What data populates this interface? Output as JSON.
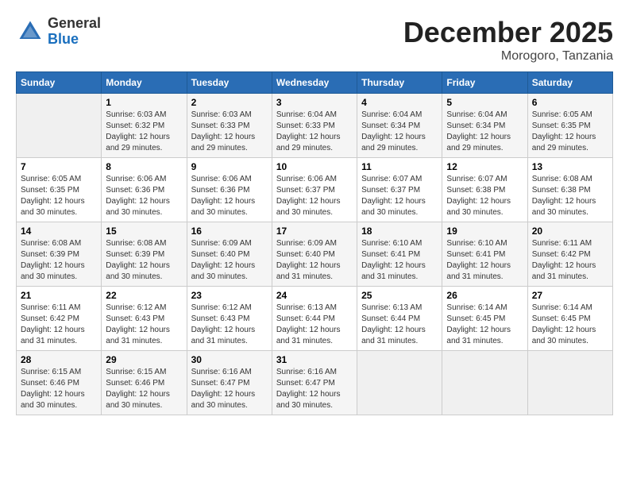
{
  "header": {
    "logo_general": "General",
    "logo_blue": "Blue",
    "month_title": "December 2025",
    "location": "Morogoro, Tanzania"
  },
  "weekdays": [
    "Sunday",
    "Monday",
    "Tuesday",
    "Wednesday",
    "Thursday",
    "Friday",
    "Saturday"
  ],
  "weeks": [
    [
      {
        "day": "",
        "sunrise": "",
        "sunset": "",
        "daylight": ""
      },
      {
        "day": "1",
        "sunrise": "Sunrise: 6:03 AM",
        "sunset": "Sunset: 6:32 PM",
        "daylight": "Daylight: 12 hours and 29 minutes."
      },
      {
        "day": "2",
        "sunrise": "Sunrise: 6:03 AM",
        "sunset": "Sunset: 6:33 PM",
        "daylight": "Daylight: 12 hours and 29 minutes."
      },
      {
        "day": "3",
        "sunrise": "Sunrise: 6:04 AM",
        "sunset": "Sunset: 6:33 PM",
        "daylight": "Daylight: 12 hours and 29 minutes."
      },
      {
        "day": "4",
        "sunrise": "Sunrise: 6:04 AM",
        "sunset": "Sunset: 6:34 PM",
        "daylight": "Daylight: 12 hours and 29 minutes."
      },
      {
        "day": "5",
        "sunrise": "Sunrise: 6:04 AM",
        "sunset": "Sunset: 6:34 PM",
        "daylight": "Daylight: 12 hours and 29 minutes."
      },
      {
        "day": "6",
        "sunrise": "Sunrise: 6:05 AM",
        "sunset": "Sunset: 6:35 PM",
        "daylight": "Daylight: 12 hours and 29 minutes."
      }
    ],
    [
      {
        "day": "7",
        "sunrise": "Sunrise: 6:05 AM",
        "sunset": "Sunset: 6:35 PM",
        "daylight": "Daylight: 12 hours and 30 minutes."
      },
      {
        "day": "8",
        "sunrise": "Sunrise: 6:06 AM",
        "sunset": "Sunset: 6:36 PM",
        "daylight": "Daylight: 12 hours and 30 minutes."
      },
      {
        "day": "9",
        "sunrise": "Sunrise: 6:06 AM",
        "sunset": "Sunset: 6:36 PM",
        "daylight": "Daylight: 12 hours and 30 minutes."
      },
      {
        "day": "10",
        "sunrise": "Sunrise: 6:06 AM",
        "sunset": "Sunset: 6:37 PM",
        "daylight": "Daylight: 12 hours and 30 minutes."
      },
      {
        "day": "11",
        "sunrise": "Sunrise: 6:07 AM",
        "sunset": "Sunset: 6:37 PM",
        "daylight": "Daylight: 12 hours and 30 minutes."
      },
      {
        "day": "12",
        "sunrise": "Sunrise: 6:07 AM",
        "sunset": "Sunset: 6:38 PM",
        "daylight": "Daylight: 12 hours and 30 minutes."
      },
      {
        "day": "13",
        "sunrise": "Sunrise: 6:08 AM",
        "sunset": "Sunset: 6:38 PM",
        "daylight": "Daylight: 12 hours and 30 minutes."
      }
    ],
    [
      {
        "day": "14",
        "sunrise": "Sunrise: 6:08 AM",
        "sunset": "Sunset: 6:39 PM",
        "daylight": "Daylight: 12 hours and 30 minutes."
      },
      {
        "day": "15",
        "sunrise": "Sunrise: 6:08 AM",
        "sunset": "Sunset: 6:39 PM",
        "daylight": "Daylight: 12 hours and 30 minutes."
      },
      {
        "day": "16",
        "sunrise": "Sunrise: 6:09 AM",
        "sunset": "Sunset: 6:40 PM",
        "daylight": "Daylight: 12 hours and 30 minutes."
      },
      {
        "day": "17",
        "sunrise": "Sunrise: 6:09 AM",
        "sunset": "Sunset: 6:40 PM",
        "daylight": "Daylight: 12 hours and 31 minutes."
      },
      {
        "day": "18",
        "sunrise": "Sunrise: 6:10 AM",
        "sunset": "Sunset: 6:41 PM",
        "daylight": "Daylight: 12 hours and 31 minutes."
      },
      {
        "day": "19",
        "sunrise": "Sunrise: 6:10 AM",
        "sunset": "Sunset: 6:41 PM",
        "daylight": "Daylight: 12 hours and 31 minutes."
      },
      {
        "day": "20",
        "sunrise": "Sunrise: 6:11 AM",
        "sunset": "Sunset: 6:42 PM",
        "daylight": "Daylight: 12 hours and 31 minutes."
      }
    ],
    [
      {
        "day": "21",
        "sunrise": "Sunrise: 6:11 AM",
        "sunset": "Sunset: 6:42 PM",
        "daylight": "Daylight: 12 hours and 31 minutes."
      },
      {
        "day": "22",
        "sunrise": "Sunrise: 6:12 AM",
        "sunset": "Sunset: 6:43 PM",
        "daylight": "Daylight: 12 hours and 31 minutes."
      },
      {
        "day": "23",
        "sunrise": "Sunrise: 6:12 AM",
        "sunset": "Sunset: 6:43 PM",
        "daylight": "Daylight: 12 hours and 31 minutes."
      },
      {
        "day": "24",
        "sunrise": "Sunrise: 6:13 AM",
        "sunset": "Sunset: 6:44 PM",
        "daylight": "Daylight: 12 hours and 31 minutes."
      },
      {
        "day": "25",
        "sunrise": "Sunrise: 6:13 AM",
        "sunset": "Sunset: 6:44 PM",
        "daylight": "Daylight: 12 hours and 31 minutes."
      },
      {
        "day": "26",
        "sunrise": "Sunrise: 6:14 AM",
        "sunset": "Sunset: 6:45 PM",
        "daylight": "Daylight: 12 hours and 31 minutes."
      },
      {
        "day": "27",
        "sunrise": "Sunrise: 6:14 AM",
        "sunset": "Sunset: 6:45 PM",
        "daylight": "Daylight: 12 hours and 30 minutes."
      }
    ],
    [
      {
        "day": "28",
        "sunrise": "Sunrise: 6:15 AM",
        "sunset": "Sunset: 6:46 PM",
        "daylight": "Daylight: 12 hours and 30 minutes."
      },
      {
        "day": "29",
        "sunrise": "Sunrise: 6:15 AM",
        "sunset": "Sunset: 6:46 PM",
        "daylight": "Daylight: 12 hours and 30 minutes."
      },
      {
        "day": "30",
        "sunrise": "Sunrise: 6:16 AM",
        "sunset": "Sunset: 6:47 PM",
        "daylight": "Daylight: 12 hours and 30 minutes."
      },
      {
        "day": "31",
        "sunrise": "Sunrise: 6:16 AM",
        "sunset": "Sunset: 6:47 PM",
        "daylight": "Daylight: 12 hours and 30 minutes."
      },
      {
        "day": "",
        "sunrise": "",
        "sunset": "",
        "daylight": ""
      },
      {
        "day": "",
        "sunrise": "",
        "sunset": "",
        "daylight": ""
      },
      {
        "day": "",
        "sunrise": "",
        "sunset": "",
        "daylight": ""
      }
    ]
  ]
}
